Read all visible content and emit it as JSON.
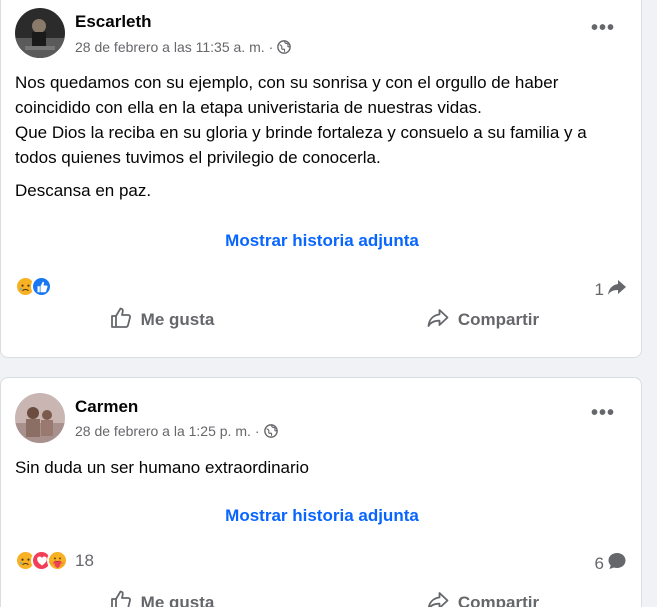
{
  "posts": [
    {
      "author": "Escarleth",
      "timestamp": "28 de febrero a las 11:35 a. m.",
      "separator": "·",
      "audience_icon": "globe-icon",
      "more_icon": "more-options-icon",
      "more_label": "•••",
      "paragraphs": [
        "Nos quedamos con su ejemplo, con su sonrisa y con el orgullo de haber coincidido con ella en  la etapa univeristaria de nuestras vidas.\nQue Dios la reciba en su gloria y brinde fortaleza y consuelo a su familia y a todos quienes tuvimos el privilegio de conocerla.",
        "Descansa en paz."
      ],
      "story_link": "Mostrar historia adjunta",
      "reactions": [
        "sad-reaction-icon",
        "like-reaction-icon"
      ],
      "reaction_count": "",
      "share_count": "1",
      "actions": {
        "like": "Me gusta",
        "share": "Compartir"
      }
    },
    {
      "author": "Carmen",
      "timestamp": "28 de febrero a la 1:25 p. m.",
      "separator": "·",
      "audience_icon": "globe-icon",
      "more_icon": "more-options-icon",
      "more_label": "•••",
      "paragraphs": [
        "Sin duda un ser humano extraordinario"
      ],
      "story_link": "Mostrar historia adjunta",
      "reactions": [
        "sad-reaction-icon",
        "love-reaction-icon",
        "care-reaction-icon"
      ],
      "reaction_count": "18",
      "comment_count": "6",
      "actions": {
        "like": "Me gusta",
        "share": "Compartir"
      }
    }
  ],
  "colors": {
    "link": "#0866ff",
    "secondary_text": "#65676b",
    "like_blue": "#1877f2",
    "love_red": "#f33e58",
    "reaction_yellow": "#f7b125"
  }
}
